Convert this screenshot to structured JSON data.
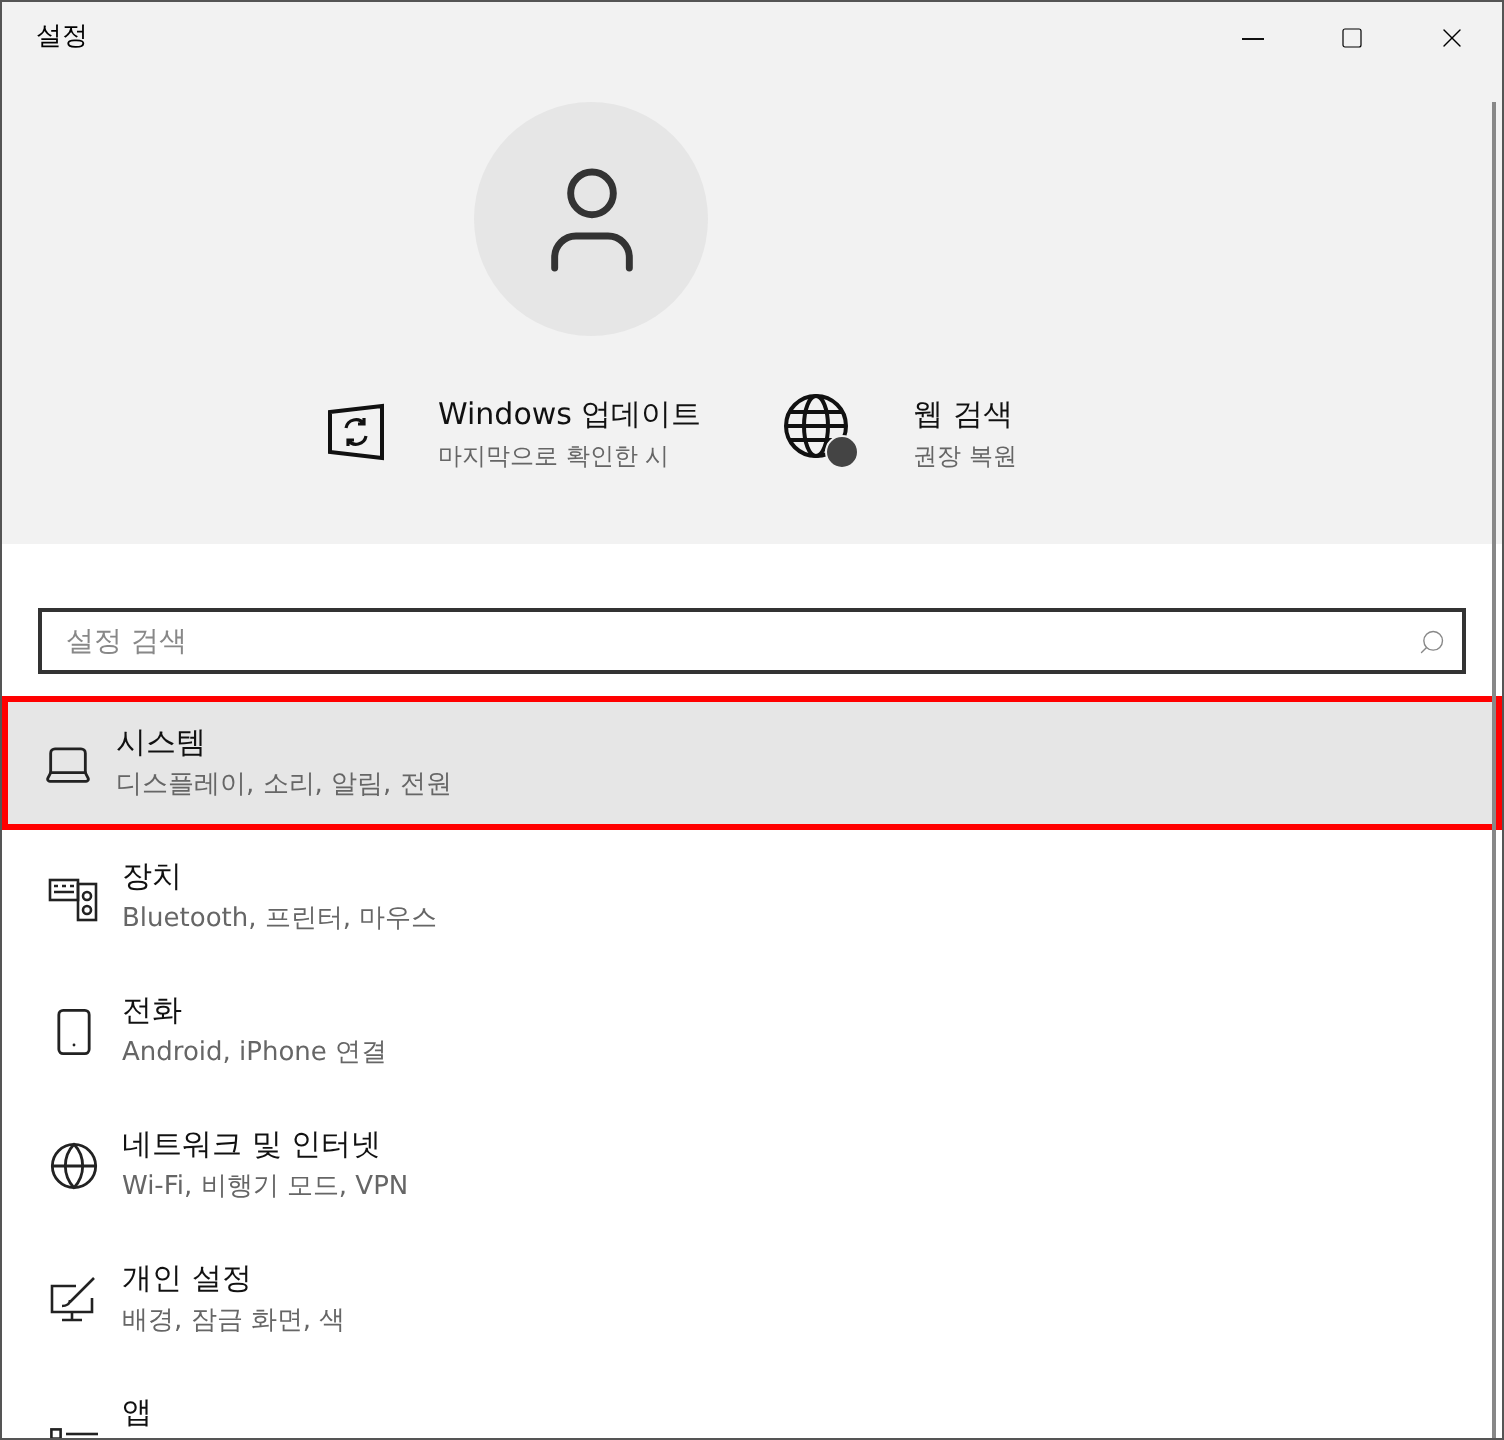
{
  "window": {
    "title": "설정"
  },
  "quick_actions": [
    {
      "kind": "update",
      "title": "Windows 업데이트",
      "subtitle": "마지막으로 확인한 시"
    },
    {
      "kind": "web",
      "title": "웹 검색",
      "subtitle": "권장 복원"
    }
  ],
  "search": {
    "placeholder": "설정 검색"
  },
  "items": [
    {
      "kind": "system",
      "title": "시스템",
      "subtitle": "디스플레이, 소리, 알림, 전원",
      "selected": true
    },
    {
      "kind": "devices",
      "title": "장치",
      "subtitle": "Bluetooth, 프린터, 마우스",
      "selected": false
    },
    {
      "kind": "phone",
      "title": "전화",
      "subtitle": "Android, iPhone 연결",
      "selected": false
    },
    {
      "kind": "network",
      "title": "네트워크 및 인터넷",
      "subtitle": "Wi-Fi, 비행기 모드, VPN",
      "selected": false
    },
    {
      "kind": "personalization",
      "title": "개인 설정",
      "subtitle": "배경, 잠금 화면, 색",
      "selected": false
    },
    {
      "kind": "apps",
      "title": "앱",
      "selected": false
    }
  ]
}
